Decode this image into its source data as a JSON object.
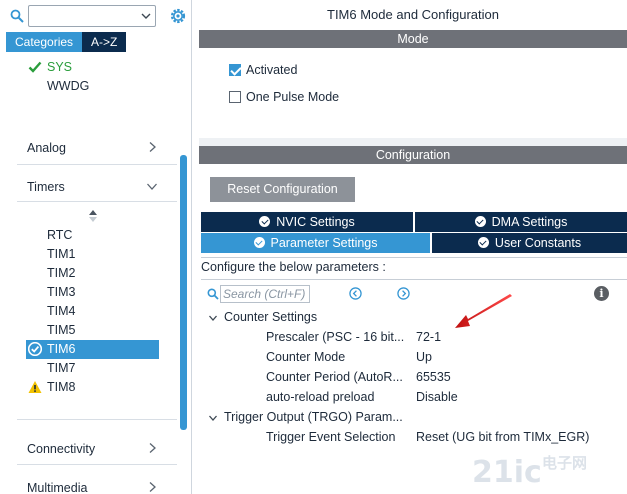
{
  "left_panel": {
    "search": {
      "value": ""
    },
    "tabs": [
      "Categories",
      "A->Z"
    ],
    "items_top": [
      "SYS",
      "WWDG"
    ],
    "categories": {
      "analog": "Analog",
      "timers": "Timers",
      "connectivity": "Connectivity",
      "multimedia": "Multimedia"
    },
    "timers": [
      "RTC",
      "TIM1",
      "TIM2",
      "TIM3",
      "TIM4",
      "TIM5",
      "TIM6",
      "TIM7",
      "TIM8"
    ],
    "selected": "TIM6"
  },
  "right_panel": {
    "title": "TIM6 Mode and Configuration",
    "mode_header": "Mode",
    "activated_label": "Activated",
    "activated_checked": true,
    "one_pulse_label": "One Pulse Mode",
    "one_pulse_checked": false,
    "config_header": "Configuration",
    "reset_button": "Reset Configuration",
    "tabs": {
      "nvic": "NVIC Settings",
      "dma": "DMA Settings",
      "parameter": "Parameter Settings",
      "user": "User Constants"
    },
    "configure_label": "Configure the below parameters :",
    "search_placeholder": "Search (Ctrl+F)",
    "groups": {
      "counter": "Counter Settings",
      "trigger": "Trigger Output (TRGO) Param..."
    },
    "params": [
      {
        "name": "Prescaler (PSC - 16 bit...",
        "value": "72-1"
      },
      {
        "name": "Counter Mode",
        "value": "Up"
      },
      {
        "name": "Counter Period (AutoR...",
        "value": "65535"
      },
      {
        "name": "auto-reload preload",
        "value": "Disable"
      },
      {
        "name": "Trigger Event Selection",
        "value": "Reset (UG bit from TIMx_EGR)"
      }
    ]
  },
  "colors": {
    "accent_blue": "#3596d3",
    "navy": "#0b2b4e",
    "band_grey": "#6e7178",
    "ok_green": "#2a9d3c",
    "warn_yellow": "#f2c200",
    "arrow_red": "#e52727"
  }
}
